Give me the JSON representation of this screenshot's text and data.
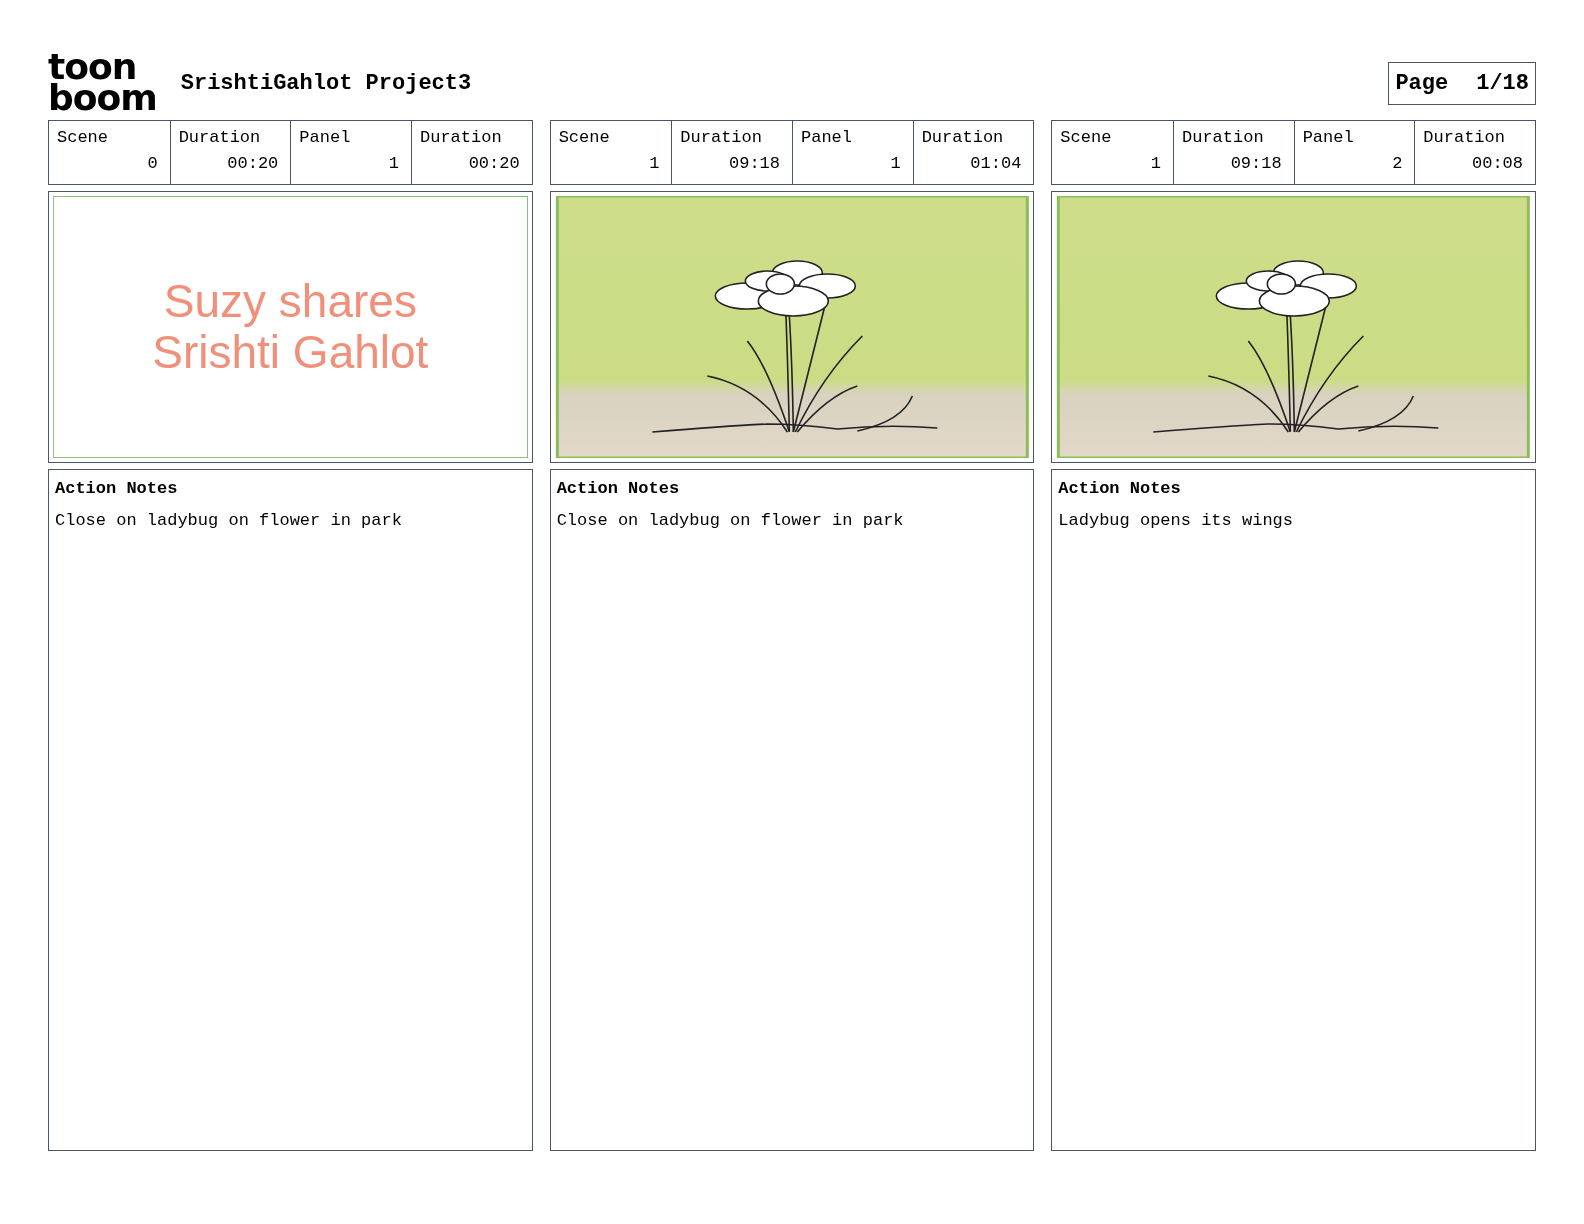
{
  "logo": {
    "line_1": "toon",
    "line_2": "boom"
  },
  "title": "SrishtiGahlot Project3",
  "page": {
    "label": "Page",
    "value": "1/18"
  },
  "panels": [
    {
      "fields": [
        {
          "label": "Scene",
          "value": "0"
        },
        {
          "label": "Duration",
          "value": "00:20"
        },
        {
          "label": "Panel",
          "value": "1"
        },
        {
          "label": "Duration",
          "value": "00:20"
        }
      ],
      "image": {
        "kind": "title_card",
        "lines": [
          "Suzy shares",
          "Srishti Gahlot"
        ]
      },
      "notes": {
        "heading": "Action Notes",
        "text": "Close on ladybug on flower in park"
      }
    },
    {
      "fields": [
        {
          "label": "Scene",
          "value": "1"
        },
        {
          "label": "Duration",
          "value": "09:18"
        },
        {
          "label": "Panel",
          "value": "1"
        },
        {
          "label": "Duration",
          "value": "01:04"
        }
      ],
      "image": {
        "kind": "drawing"
      },
      "notes": {
        "heading": "Action Notes",
        "text": "Close on ladybug on flower in park"
      }
    },
    {
      "fields": [
        {
          "label": "Scene",
          "value": "1"
        },
        {
          "label": "Duration",
          "value": "09:18"
        },
        {
          "label": "Panel",
          "value": "2"
        },
        {
          "label": "Duration",
          "value": "00:08"
        }
      ],
      "image": {
        "kind": "drawing"
      },
      "notes": {
        "heading": "Action Notes",
        "text": "Ladybug opens its wings"
      }
    }
  ]
}
